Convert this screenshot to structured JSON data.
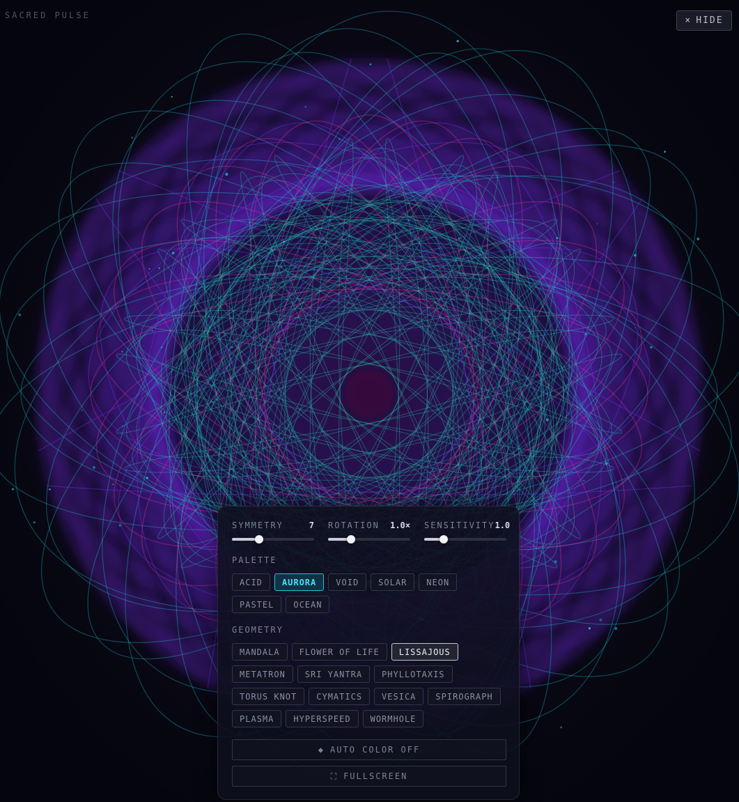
{
  "app": {
    "title": "SACRED PULSE",
    "hide_icon": "×",
    "hide_label": "HIDE"
  },
  "controls": {
    "sliders": [
      {
        "label": "SYMMETRY",
        "value_text": "7",
        "fraction": 0.33
      },
      {
        "label": "ROTATION",
        "value_text": "1.0×",
        "fraction": 0.28
      },
      {
        "label": "SENSITIVITY",
        "value_text": "1.0",
        "fraction": 0.24
      }
    ],
    "palette": {
      "label": "PALETTE",
      "options": [
        "ACID",
        "AURORA",
        "VOID",
        "SOLAR",
        "NEON",
        "PASTEL",
        "OCEAN"
      ],
      "selected": "AURORA"
    },
    "geometry": {
      "label": "GEOMETRY",
      "options": [
        "MANDALA",
        "FLOWER OF LIFE",
        "LISSAJOUS",
        "METATRON",
        "SRI YANTRA",
        "PHYLLOTAXIS",
        "TORUS KNOT",
        "CYMATICS",
        "VESICA",
        "SPIROGRAPH",
        "PLASMA",
        "HYPERSPEED",
        "WORMHOLE"
      ],
      "selected": "LISSAJOUS"
    },
    "auto_color": {
      "icon": "◆",
      "label": "AUTO COLOR OFF"
    },
    "fullscreen": {
      "icon": "⛶",
      "label": "FULLSCREEN"
    }
  },
  "colors": {
    "teal": "#21d6b5",
    "cyan": "#19c9d6",
    "violet": "#7a2cf0",
    "magenta": "#e0309c",
    "background": "#05060d"
  }
}
